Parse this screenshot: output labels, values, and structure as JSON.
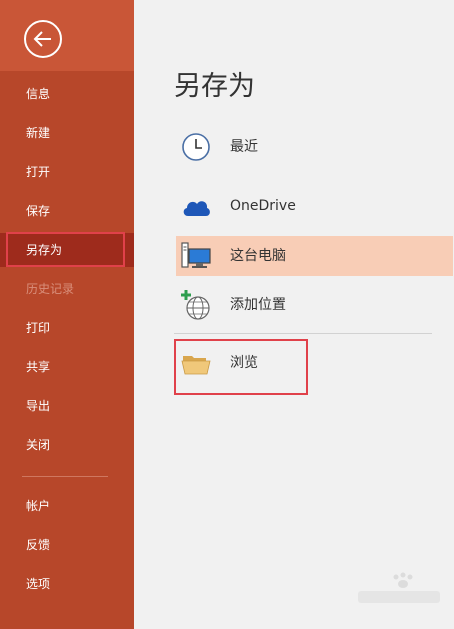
{
  "sidebar": {
    "back": {
      "icon": "arrow-left-icon"
    },
    "items": [
      {
        "label": "信息"
      },
      {
        "label": "新建"
      },
      {
        "label": "打开"
      },
      {
        "label": "保存"
      },
      {
        "label": "另存为",
        "state": "selected"
      },
      {
        "label": "历史记录",
        "state": "disabled"
      },
      {
        "label": "打印"
      },
      {
        "label": "共享"
      },
      {
        "label": "导出"
      },
      {
        "label": "关闭"
      },
      {
        "label": "帐户"
      },
      {
        "label": "反馈"
      },
      {
        "label": "选项"
      }
    ]
  },
  "main": {
    "title": "另存为",
    "locations": [
      {
        "label": "最近",
        "icon": "clock-icon"
      },
      {
        "label": "OneDrive",
        "icon": "cloud-icon"
      },
      {
        "label": "这台电脑",
        "icon": "computer-icon",
        "state": "selected"
      },
      {
        "label": "添加位置",
        "icon": "add-globe-icon"
      },
      {
        "label": "浏览",
        "icon": "folder-icon"
      }
    ]
  },
  "colors": {
    "sidebar": "#b7472a",
    "sidebar_selected": "#9e2b1c",
    "back_area": "#c95637",
    "main_bg": "#f1f1f1",
    "location_selected": "#f8cdb6",
    "highlight_outline": "#e0414a"
  }
}
